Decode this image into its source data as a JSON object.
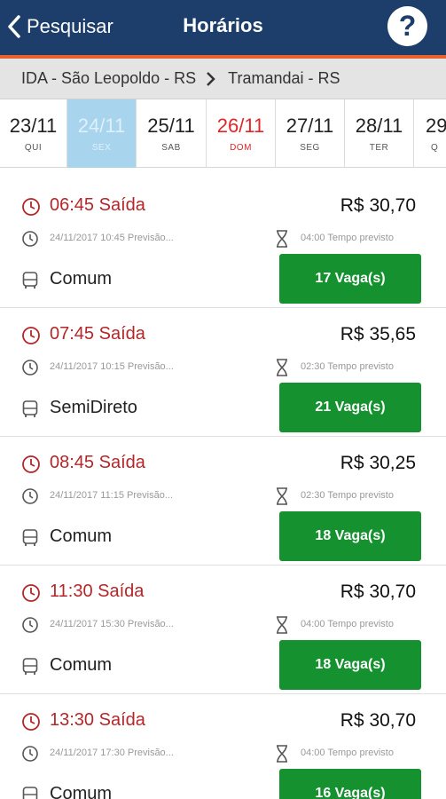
{
  "header": {
    "back_label": "Pesquisar",
    "title": "Horários",
    "help_label": "?"
  },
  "route": {
    "origin": "IDA - São Leopoldo - RS",
    "destination": "Tramandai - RS"
  },
  "dates": [
    {
      "date": "23/11",
      "weekday": "QUI",
      "state": "normal"
    },
    {
      "date": "24/11",
      "weekday": "SEX",
      "state": "selected"
    },
    {
      "date": "25/11",
      "weekday": "SAB",
      "state": "normal"
    },
    {
      "date": "26/11",
      "weekday": "DOM",
      "state": "sunday"
    },
    {
      "date": "27/11",
      "weekday": "SEG",
      "state": "normal"
    },
    {
      "date": "28/11",
      "weekday": "TER",
      "state": "normal"
    },
    {
      "date": "29",
      "weekday": "Q",
      "state": "normal"
    }
  ],
  "trips": [
    {
      "departure": "06:45 Saída",
      "price": "R$ 30,70",
      "arrival": "24/11/2017 10:45 Previsão...",
      "duration": "04:00 Tempo previsto",
      "service": "Comum",
      "seats": "17 Vaga(s)"
    },
    {
      "departure": "07:45 Saída",
      "price": "R$ 35,65",
      "arrival": "24/11/2017 10:15 Previsão...",
      "duration": "02:30 Tempo previsto",
      "service": "SemiDireto",
      "seats": "21 Vaga(s)"
    },
    {
      "departure": "08:45 Saída",
      "price": "R$ 30,25",
      "arrival": "24/11/2017 11:15 Previsão...",
      "duration": "02:30 Tempo previsto",
      "service": "Comum",
      "seats": "18 Vaga(s)"
    },
    {
      "departure": "11:30 Saída",
      "price": "R$ 30,70",
      "arrival": "24/11/2017 15:30 Previsão...",
      "duration": "04:00 Tempo previsto",
      "service": "Comum",
      "seats": "18 Vaga(s)"
    },
    {
      "departure": "13:30 Saída",
      "price": "R$ 30,70",
      "arrival": "24/11/2017 17:30 Previsão...",
      "duration": "04:00 Tempo previsto",
      "service": "Comum",
      "seats": "16 Vaga(s)"
    }
  ],
  "colors": {
    "header_bg": "#1d3e6a",
    "accent": "#e8632c",
    "departure_red": "#b4262a",
    "seats_green": "#15912f",
    "selected_date": "#a8d4ee",
    "sunday_red": "#e0262b"
  },
  "icons": {
    "back": "chevron-left-icon",
    "help": "question-icon",
    "route_separator": "chevron-right-icon",
    "departure": "clock-icon",
    "arrival": "clock-icon",
    "duration": "hourglass-icon",
    "service": "bus-icon"
  }
}
